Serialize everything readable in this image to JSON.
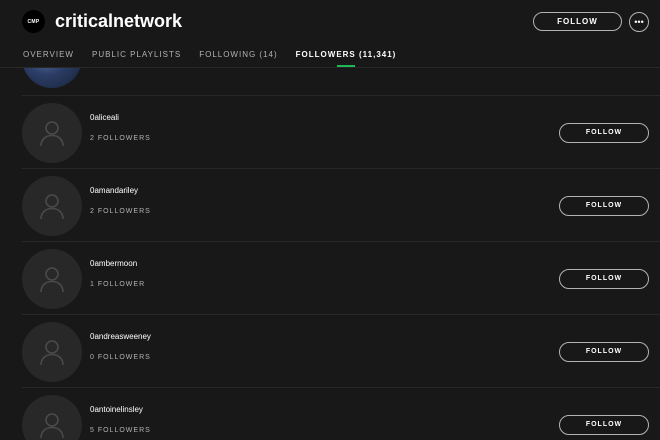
{
  "header": {
    "logo_text": "CMP",
    "title": "criticalnetwork",
    "follow_label": "FOLLOW",
    "more_label": "•••"
  },
  "tabs": [
    {
      "label": "OVERVIEW",
      "active": false
    },
    {
      "label": "PUBLIC PLAYLISTS",
      "active": false
    },
    {
      "label": "FOLLOWING (14)",
      "active": false
    },
    {
      "label": "FOLLOWERS (11,341)",
      "active": true
    }
  ],
  "colors": {
    "background": "#181818",
    "accent": "#1db954",
    "muted_text": "#b3b3b3",
    "avatar_placeholder": "#282828"
  },
  "followers": [
    {
      "name": "0aliceali",
      "count": "2 FOLLOWERS",
      "button": "FOLLOW",
      "avatar_icon": "user-icon"
    },
    {
      "name": "0amandariley",
      "count": "2 FOLLOWERS",
      "button": "FOLLOW",
      "avatar_icon": "user-icon"
    },
    {
      "name": "0ambermoon",
      "count": "1 FOLLOWER",
      "button": "FOLLOW",
      "avatar_icon": "user-icon"
    },
    {
      "name": "0andreasweeney",
      "count": "0 FOLLOWERS",
      "button": "FOLLOW",
      "avatar_icon": "user-icon"
    },
    {
      "name": "0antoinelinsley",
      "count": "5 FOLLOWERS",
      "button": "FOLLOW",
      "avatar_icon": "user-icon"
    }
  ]
}
